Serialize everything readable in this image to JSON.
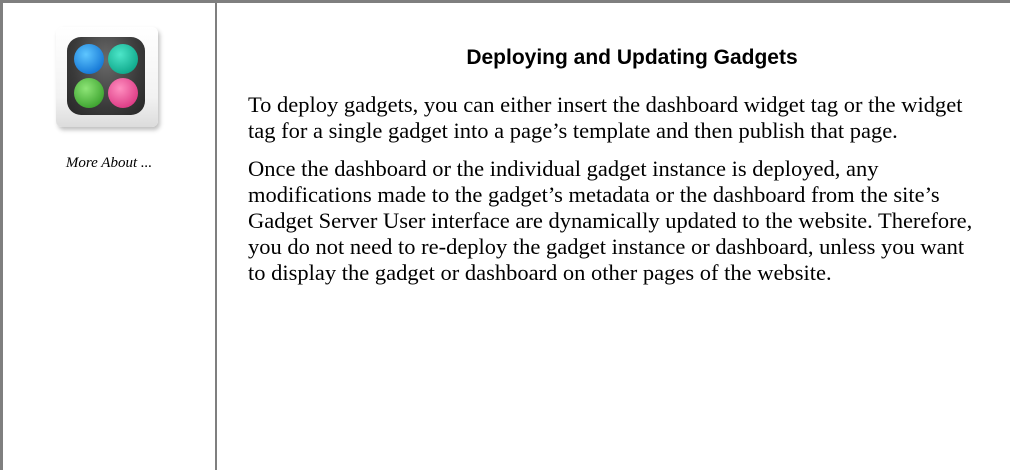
{
  "sidebar": {
    "icon": "gadgets-app-icon",
    "dot_colors": [
      "#1f8fe8",
      "#17bfa0",
      "#52c043",
      "#ee4f98"
    ],
    "caption": "More About ..."
  },
  "content": {
    "title": "Deploying and Updating Gadgets",
    "paragraphs": [
      "To deploy gadgets, you can either insert the dashboard widget tag or the widget tag for a single gadget into a page’s template and then publish that page.",
      "Once the dashboard or the individual gadget instance is deployed, any modifications made to the gadget’s metadata or the dashboard from the site’s Gadget Server User interface are dynamically updated to the website. Therefore, you do not need to re-deploy the gadget instance or dashboard, unless you want to display the gadget or dashboard on other pages of the website."
    ]
  }
}
